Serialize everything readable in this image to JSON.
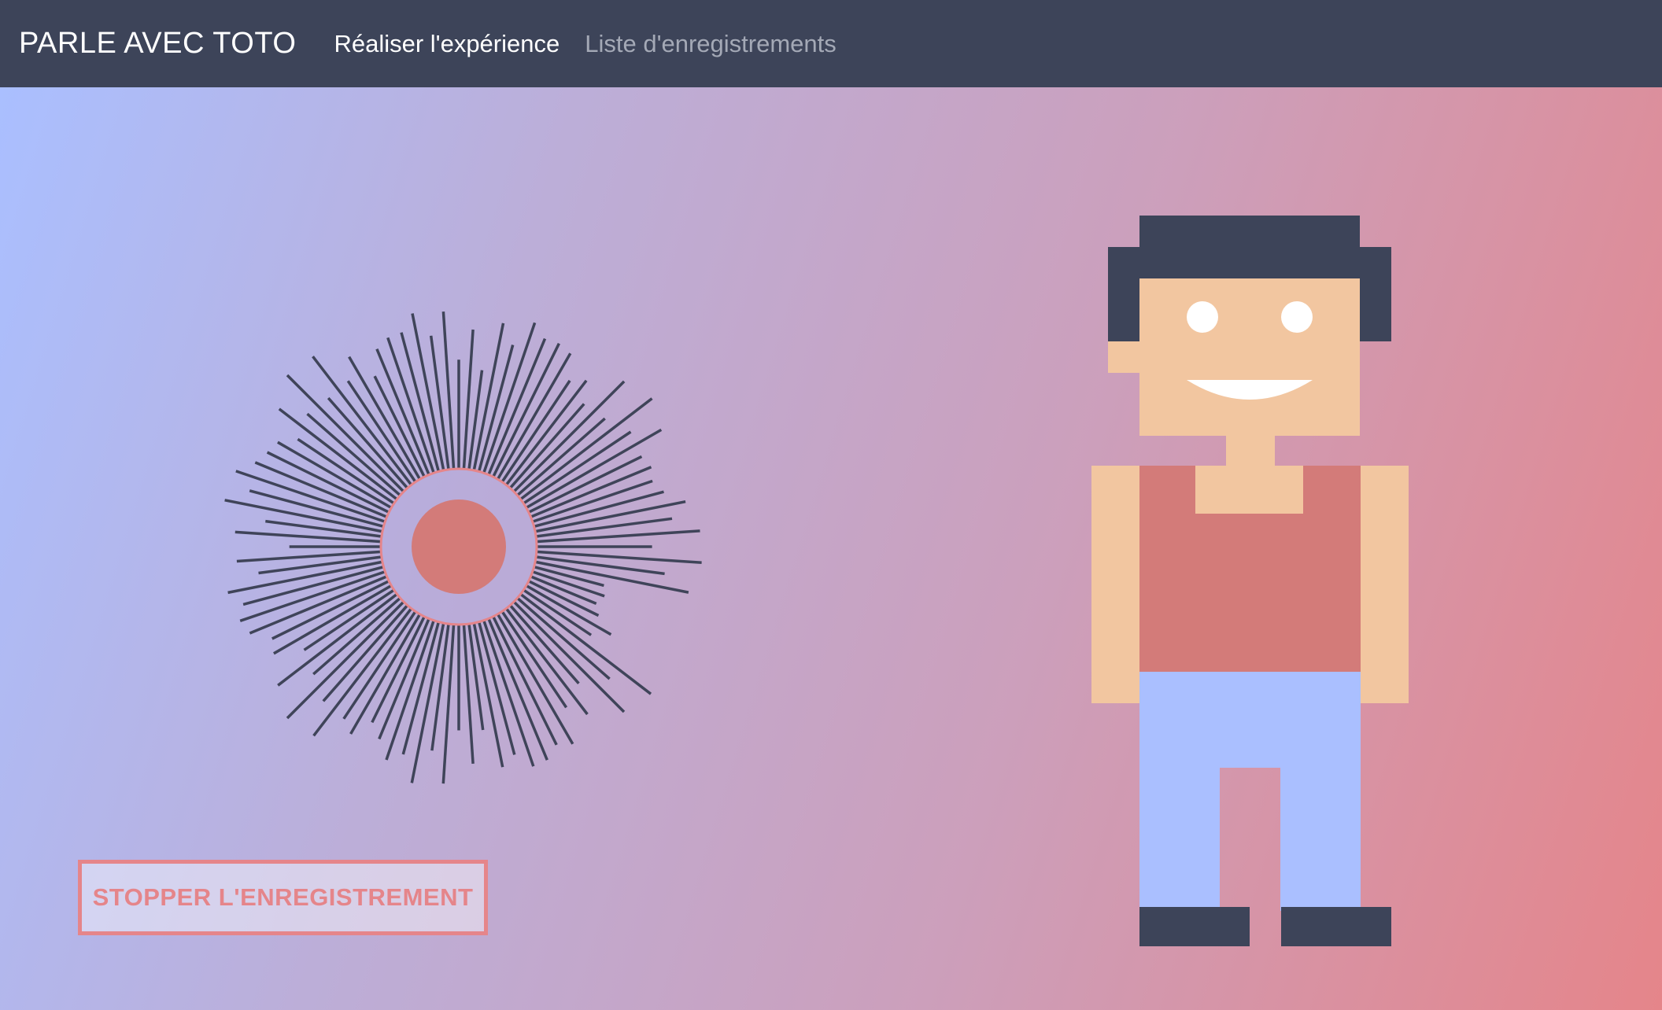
{
  "navbar": {
    "brand": "PARLE AVEC TOTO",
    "links": [
      {
        "label": "Réaliser l'expérience",
        "active": true
      },
      {
        "label": "Liste d'enregistrements",
        "active": false
      }
    ]
  },
  "recorder": {
    "stop_label": "STOPPER L'ENREGISTREMENT"
  },
  "colors": {
    "navbar_bg": "#3d4459",
    "accent": "#e5858a",
    "record_dot": "#d37b79",
    "bars": "#3f4459",
    "skin": "#f2c6a0",
    "hair": "#3d4459",
    "shirt": "#d37b79",
    "pants": "#aabfff",
    "shoes": "#3d4459"
  },
  "icons": {
    "recording": "record-dot-icon",
    "avatar": "pixel-character-toto"
  }
}
